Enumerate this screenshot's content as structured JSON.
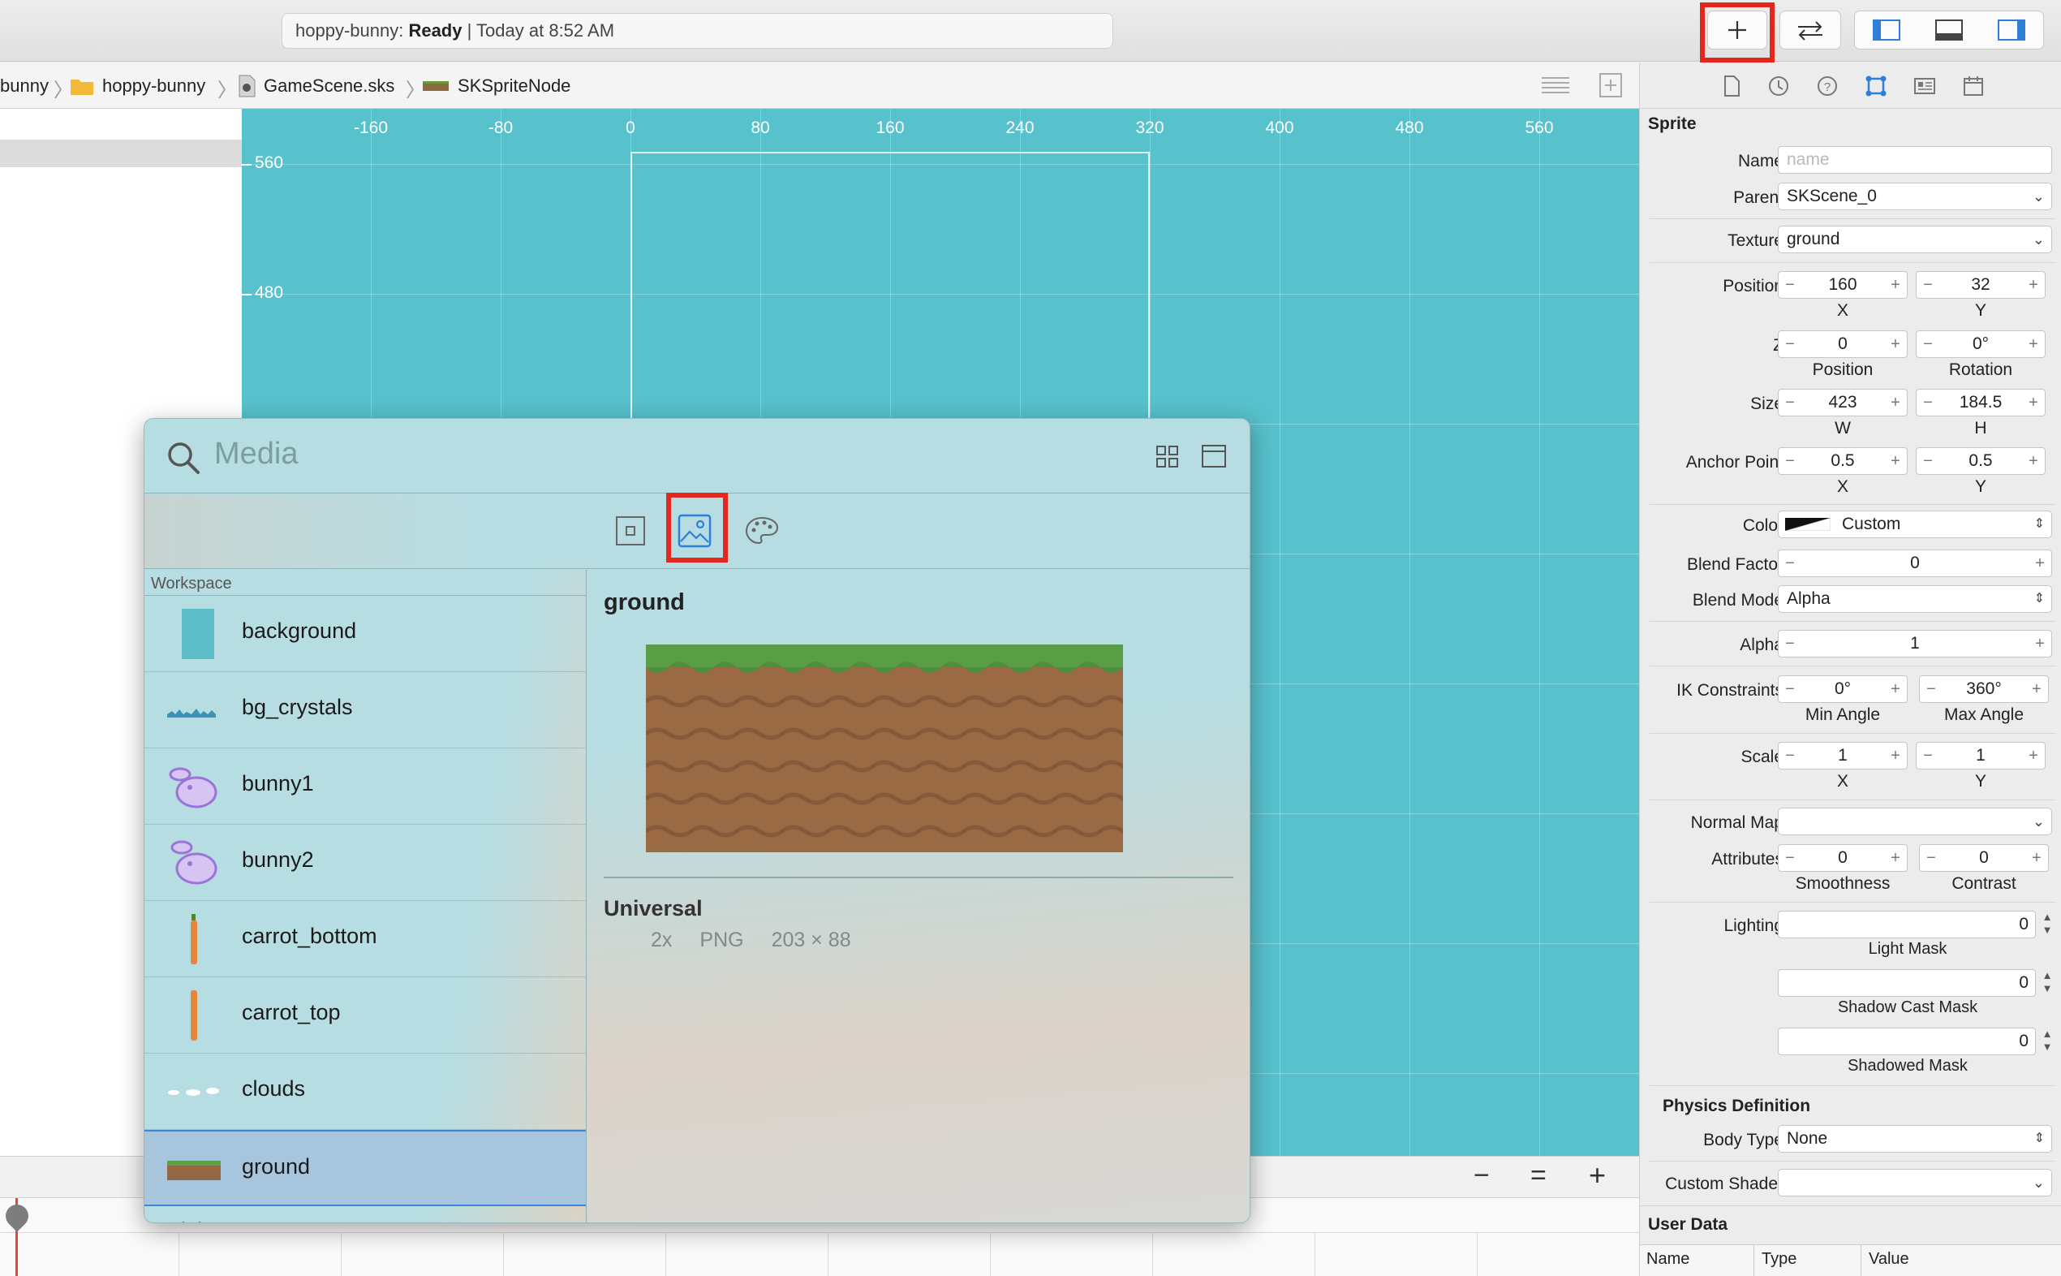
{
  "toolbar": {
    "status_project": "hoppy-bunny:",
    "status_state": "Ready",
    "status_time": "| Today at 8:52 AM"
  },
  "breadcrumb": {
    "item0": "bunny",
    "item1": "hoppy-bunny",
    "item2": "GameScene.sks",
    "item3": "SKSpriteNode"
  },
  "canvas": {
    "x_ruler": [
      "-160",
      "-80",
      "0",
      "80",
      "160",
      "240",
      "320",
      "400",
      "480",
      "560"
    ],
    "y_ruler": [
      "560",
      "480"
    ]
  },
  "zoom": {
    "minus": "−",
    "equal": "=",
    "plus": "+"
  },
  "inspector": {
    "section": "Sprite",
    "name_label": "Name",
    "name_placeholder": "name",
    "parent_label": "Parent",
    "parent_value": "SKScene_0",
    "texture_label": "Texture",
    "texture_value": "ground",
    "position_label": "Position",
    "position_x": "160",
    "position_y": "32",
    "x": "X",
    "y": "Y",
    "z_label": "Z",
    "z_position": "0",
    "z_rotation": "0°",
    "z_position_label": "Position",
    "z_rotation_label": "Rotation",
    "size_label": "Size",
    "size_w": "423",
    "size_h": "184.5",
    "w": "W",
    "h": "H",
    "anchor_label": "Anchor Point",
    "anchor_x": "0.5",
    "anchor_y": "0.5",
    "color_label": "Color",
    "color_value": "Custom",
    "blend_factor_label": "Blend Factor",
    "blend_factor_value": "0",
    "blend_mode_label": "Blend Mode",
    "blend_mode_value": "Alpha",
    "alpha_label": "Alpha",
    "alpha_value": "1",
    "ik_label": "IK Constraints",
    "ik_min": "0°",
    "ik_max": "360°",
    "ik_min_label": "Min Angle",
    "ik_max_label": "Max Angle",
    "scale_label": "Scale",
    "scale_x": "1",
    "scale_y": "1",
    "normal_map_label": "Normal Map",
    "attributes_label": "Attributes",
    "smoothness": "0",
    "contrast": "0",
    "smoothness_label": "Smoothness",
    "contrast_label": "Contrast",
    "lighting_label": "Lighting",
    "light_mask": "0",
    "light_mask_label": "Light Mask",
    "shadow_cast_mask": "0",
    "shadow_cast_label": "Shadow Cast Mask",
    "shadowed_mask": "0",
    "shadowed_label": "Shadowed Mask",
    "physics_title": "Physics Definition",
    "body_type_label": "Body Type",
    "body_type_value": "None",
    "custom_shader_label": "Custom Shader",
    "user_data_title": "User Data",
    "col_name": "Name",
    "col_type": "Type",
    "col_value": "Value"
  },
  "media": {
    "search_placeholder": "Media",
    "workspace_label": "Workspace",
    "items": [
      {
        "name": "background",
        "thumb": "background-thumbnail"
      },
      {
        "name": "bg_crystals",
        "thumb": "crystals-thumbnail"
      },
      {
        "name": "bunny1",
        "thumb": "bunny-thumbnail"
      },
      {
        "name": "bunny2",
        "thumb": "bunny-thumbnail"
      },
      {
        "name": "carrot_bottom",
        "thumb": "carrot-thumbnail"
      },
      {
        "name": "carrot_top",
        "thumb": "carrot-thumbnail"
      },
      {
        "name": "clouds",
        "thumb": "clouds-thumbnail"
      },
      {
        "name": "ground",
        "thumb": "ground-thumbnail"
      }
    ],
    "selected": "ground",
    "detail_title": "ground",
    "detail_universal": "Universal",
    "detail_scale": "2x",
    "detail_format": "PNG",
    "detail_size": "203 × 88"
  },
  "colors": {
    "canvas": "#57c1cc",
    "highlight_box": "#e5261c",
    "selection": "#3b86d6"
  }
}
